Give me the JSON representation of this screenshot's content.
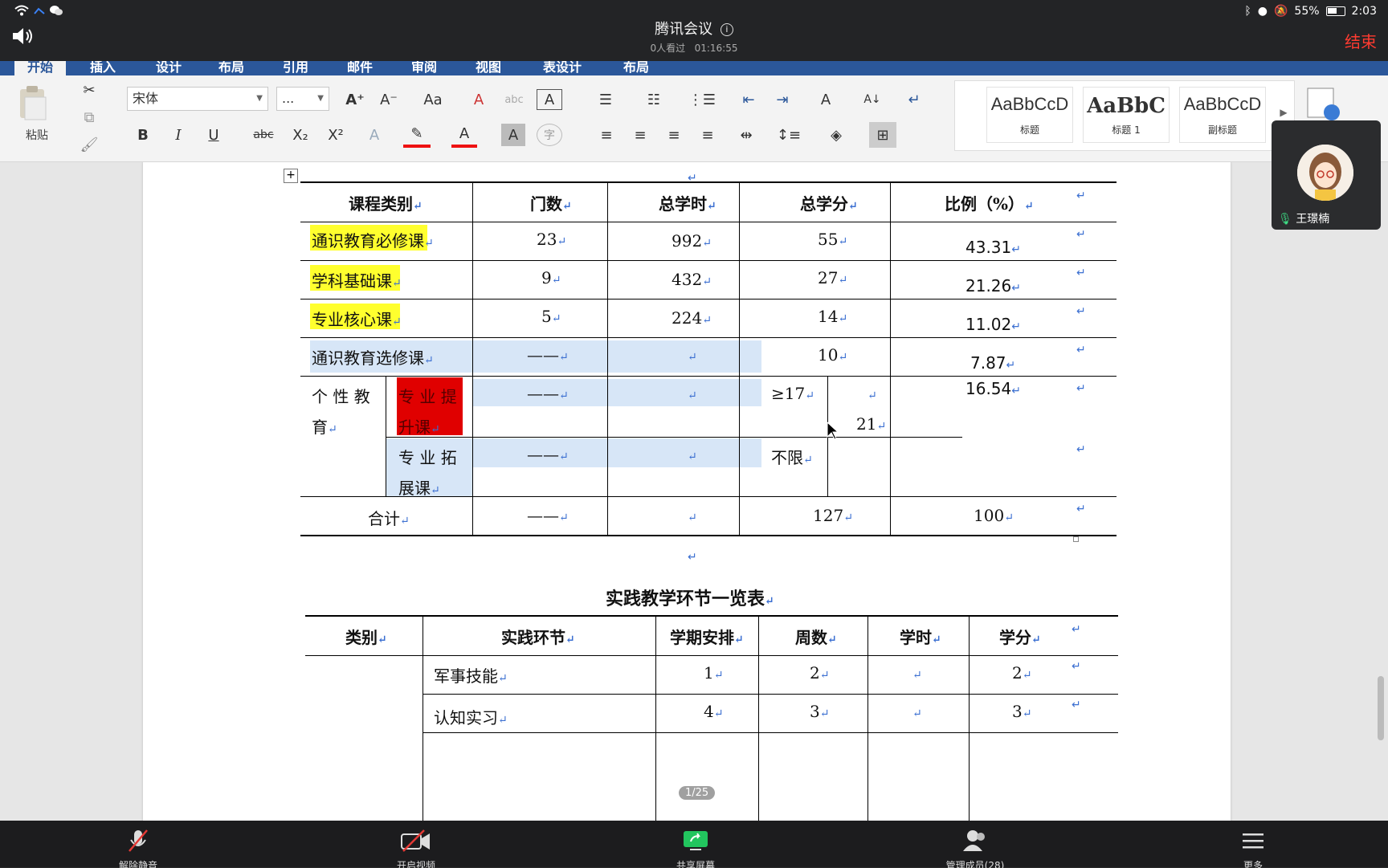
{
  "meeting": {
    "title": "腾讯会议",
    "viewers": "0人看过",
    "elapsed": "01:16:55",
    "end_label": "结束",
    "battery": "55%",
    "time": "2:03"
  },
  "ribbon": {
    "tabs": [
      "开始",
      "插入",
      "设计",
      "布局",
      "引用",
      "邮件",
      "审阅",
      "视图",
      "表设计",
      "布局"
    ],
    "active_tab": "开始",
    "paste_label": "粘贴",
    "font_name": "宋体",
    "font_size": "...",
    "styles": [
      {
        "sample": "AaBbCcD",
        "name": "标题"
      },
      {
        "sample": "AaBbC",
        "name": "标题 1"
      },
      {
        "sample": "AaBbCcD",
        "name": "副标题"
      }
    ]
  },
  "participant": {
    "name": "王璟楠"
  },
  "table1": {
    "headers": [
      "课程类别",
      "门数",
      "总学时",
      "总学分",
      "比例（%）"
    ],
    "rows": [
      {
        "category": "通识教育必修课",
        "count": "23",
        "hours": "992",
        "credits": "55",
        "ratio": "43.31"
      },
      {
        "category": "学科基础课",
        "count": "9",
        "hours": "432",
        "credits": "27",
        "ratio": "21.26"
      },
      {
        "category": "专业核心课",
        "count": "5",
        "hours": "224",
        "credits": "14",
        "ratio": "11.02"
      },
      {
        "category": "通识教育选修课",
        "count": "——",
        "hours": "",
        "credits": "10",
        "ratio": "7.87"
      }
    ],
    "personal": {
      "label_line1": "个 性 教",
      "label_line2": "育",
      "sub1_line1": "专 业 提",
      "sub1_line2": "升课",
      "sub1_count": "——",
      "sub1_credits": "≥17",
      "sub2_line1": "专 业 拓",
      "sub2_line2": "展课",
      "sub2_count": "——",
      "sub2_credits": "不限",
      "merged_credits": "21",
      "ratio": "16.54"
    },
    "total": {
      "label": "合计",
      "count": "——",
      "credits": "127",
      "ratio": "100"
    }
  },
  "table2": {
    "title": "实践教学环节一览表",
    "headers": [
      "类别",
      "实践环节",
      "学期安排",
      "周数",
      "学时",
      "学分"
    ],
    "rows": [
      {
        "name": "军事技能",
        "term": "1",
        "weeks": "2",
        "hours": "",
        "credits": "2"
      },
      {
        "name": "认知实习",
        "term": "4",
        "weeks": "3",
        "hours": "",
        "credits": "3"
      }
    ]
  },
  "page_indicator": "1/25",
  "bottom": [
    "解除静音",
    "开启视频",
    "共享屏幕",
    "管理成员(28)",
    "更多"
  ]
}
